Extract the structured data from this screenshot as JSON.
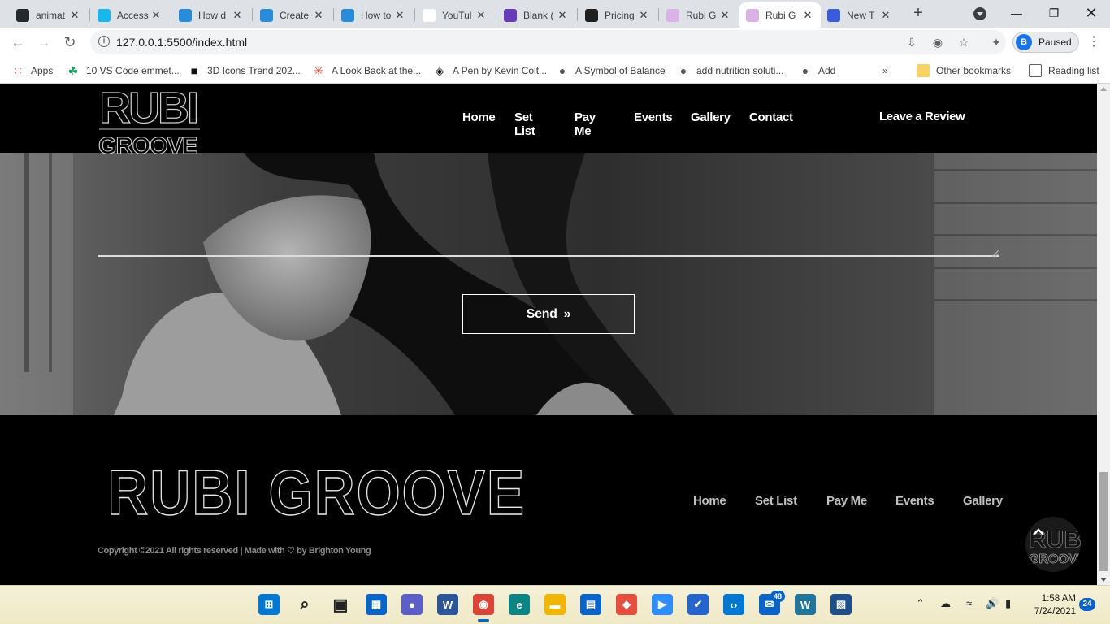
{
  "browser": {
    "tabs": [
      {
        "label": "animat",
        "icon": "github-icon",
        "color": "#24292e"
      },
      {
        "label": "Access",
        "icon": "vimeo-icon",
        "color": "#1ab7ea"
      },
      {
        "label": "How d",
        "icon": "x-icon",
        "color": "#2a8cd8"
      },
      {
        "label": "Create",
        "icon": "x-icon",
        "color": "#2a8cd8"
      },
      {
        "label": "How to",
        "icon": "x-icon",
        "color": "#2a8cd8"
      },
      {
        "label": "YouTul",
        "icon": "code-icon",
        "color": "#ffffff"
      },
      {
        "label": "Blank (",
        "icon": "form-icon",
        "color": "#673ab7"
      },
      {
        "label": "Pricing",
        "icon": "ticket-icon",
        "color": "#1f1f1f"
      },
      {
        "label": "Rubi G",
        "icon": "vinyl-icon",
        "color": "#d9b3e6"
      },
      {
        "label": "Rubi G",
        "icon": "vinyl-icon",
        "color": "#d9b3e6"
      },
      {
        "label": "New T",
        "icon": "link-icon",
        "color": "#3b5bdb"
      }
    ],
    "active_tab_index": 9,
    "url": "127.0.0.1:5500/index.html",
    "profile_initial": "B",
    "profile_label": "Paused",
    "bookmarks": [
      {
        "label": "Apps",
        "icon": "apps-grid-icon"
      },
      {
        "label": "10 VS Code emmet...",
        "icon": "leaf-icon"
      },
      {
        "label": "3D Icons Trend 202...",
        "icon": "cube-icon"
      },
      {
        "label": "A Look Back at the...",
        "icon": "asterisk-icon"
      },
      {
        "label": "A Pen by Kevin Colt...",
        "icon": "codepen-icon"
      },
      {
        "label": "A Symbol of Balance",
        "icon": "globe-icon"
      },
      {
        "label": "add nutrition soluti...",
        "icon": "globe-icon"
      },
      {
        "label": "Add",
        "icon": "globe-icon"
      }
    ],
    "bookmarks_overflow": "»",
    "other_bookmarks": "Other bookmarks",
    "reading_list": "Reading list"
  },
  "site": {
    "logo_top": "RUBI",
    "logo_bottom": "GROOVE",
    "nav": [
      "Home",
      "Set List",
      "Pay Me",
      "Events",
      "Gallery",
      "Contact"
    ],
    "review_link": "Leave a Review",
    "send_label": "Send",
    "send_chevron": "»",
    "footer_logo": "RUBI GROOVE",
    "footer_nav": [
      "Home",
      "Set List",
      "Pay Me",
      "Events",
      "Gallery"
    ],
    "copyright_before": "Copyright ©2021 All rights reserved | Made with",
    "copyright_heart": "♡",
    "copyright_after": "by Brighton Young",
    "back_to_top": "^"
  },
  "taskbar": {
    "apps": [
      {
        "name": "start-icon",
        "color": "#0078d4"
      },
      {
        "name": "search-icon",
        "color": "#222222"
      },
      {
        "name": "task-view-icon",
        "color": "#222222"
      },
      {
        "name": "widgets-icon",
        "color": "#0a63c9"
      },
      {
        "name": "teams-chat-icon",
        "color": "#5b5fc7"
      },
      {
        "name": "word-icon",
        "color": "#2b579a"
      },
      {
        "name": "chrome-icon",
        "color": "#db4437"
      },
      {
        "name": "edge-icon",
        "color": "#0c8484"
      },
      {
        "name": "file-explorer-icon",
        "color": "#f2b600"
      },
      {
        "name": "store-icon",
        "color": "#0a63c9"
      },
      {
        "name": "git-icon",
        "color": "#e84e40"
      },
      {
        "name": "zoom-icon",
        "color": "#2d8cff"
      },
      {
        "name": "todo-icon",
        "color": "#2564cf"
      },
      {
        "name": "vscode-icon",
        "color": "#0078d4"
      },
      {
        "name": "mail-icon",
        "color": "#0a63c9"
      },
      {
        "name": "wordpress-icon",
        "color": "#21759b"
      },
      {
        "name": "app-icon",
        "color": "#1e4f8a"
      }
    ],
    "mail_badge": "48",
    "time": "1:58 AM",
    "date": "7/24/2021",
    "notifications": "24"
  }
}
